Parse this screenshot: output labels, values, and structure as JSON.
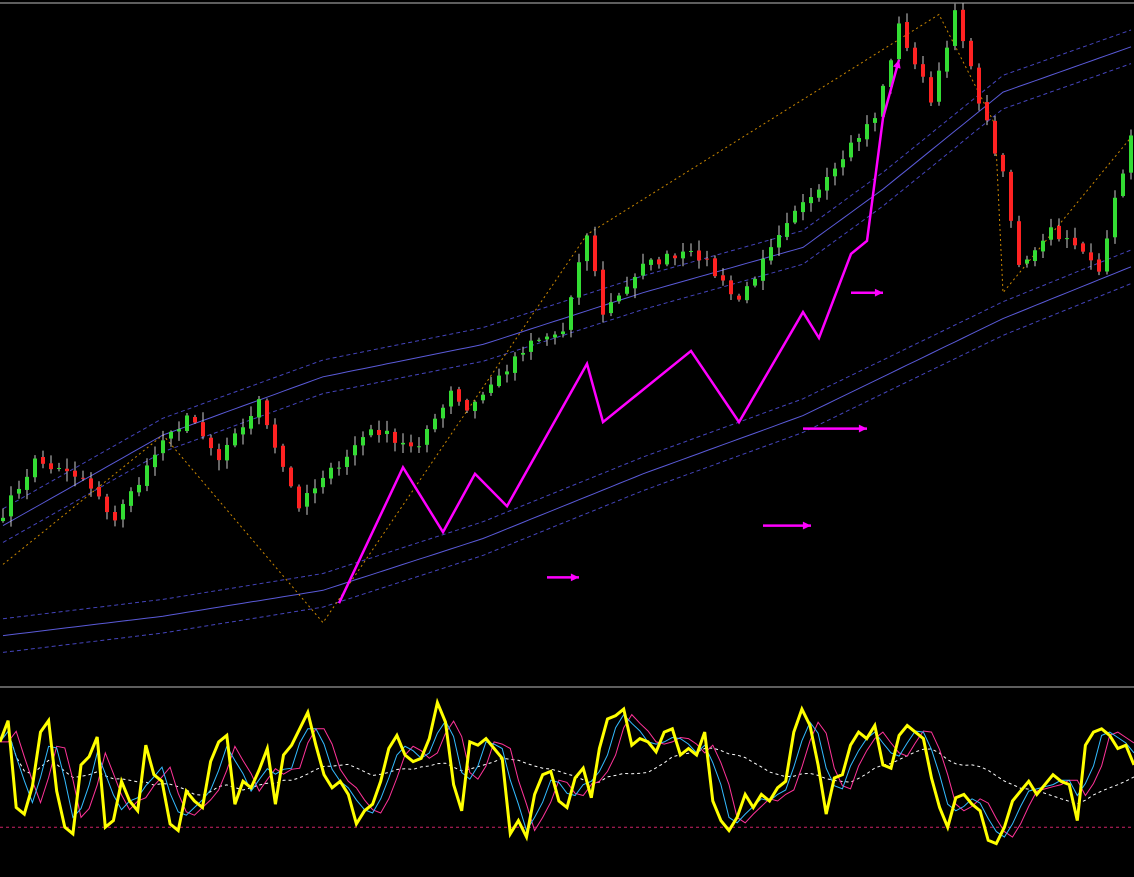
{
  "chart_data": [
    {
      "type": "candlestick",
      "panel": "price",
      "grid": false,
      "legend": "none",
      "y_range": [
        0,
        100
      ],
      "colors": {
        "background": "#000000",
        "bull_candle": "#33dd33",
        "bear_candle": "#ff2222",
        "wick": "#cccccc",
        "envelope_solid": "#5a5ad8",
        "envelope_dashed": "#4444bb",
        "zigzag": "#cc8800",
        "annotation_arrows": "#ff00ff"
      },
      "price_path": [
        {
          "i": 0,
          "v": 22
        },
        {
          "i": 4,
          "v": 30
        },
        {
          "i": 10,
          "v": 27
        },
        {
          "i": 14,
          "v": 21
        },
        {
          "i": 19,
          "v": 31
        },
        {
          "i": 23,
          "v": 37
        },
        {
          "i": 27,
          "v": 30
        },
        {
          "i": 32,
          "v": 39
        },
        {
          "i": 37,
          "v": 23
        },
        {
          "i": 46,
          "v": 35
        },
        {
          "i": 52,
          "v": 32
        },
        {
          "i": 56,
          "v": 41
        },
        {
          "i": 58,
          "v": 38
        },
        {
          "i": 66,
          "v": 48
        },
        {
          "i": 70,
          "v": 50
        },
        {
          "i": 73,
          "v": 65
        },
        {
          "i": 75,
          "v": 53
        },
        {
          "i": 80,
          "v": 60
        },
        {
          "i": 86,
          "v": 63
        },
        {
          "i": 92,
          "v": 55
        },
        {
          "i": 99,
          "v": 68
        },
        {
          "i": 106,
          "v": 79
        },
        {
          "i": 109,
          "v": 83
        },
        {
          "i": 112,
          "v": 97
        },
        {
          "i": 116,
          "v": 86
        },
        {
          "i": 119,
          "v": 99
        },
        {
          "i": 122,
          "v": 86
        },
        {
          "i": 125,
          "v": 74
        },
        {
          "i": 127,
          "v": 60
        },
        {
          "i": 131,
          "v": 66
        },
        {
          "i": 137,
          "v": 60
        },
        {
          "i": 141,
          "v": 80
        }
      ],
      "envelope_upper": [
        [
          0,
          20
        ],
        [
          20,
          34
        ],
        [
          40,
          43
        ],
        [
          60,
          48
        ],
        [
          80,
          56
        ],
        [
          100,
          63
        ],
        [
          110,
          72
        ],
        [
          125,
          87
        ],
        [
          141,
          94
        ]
      ],
      "envelope_lower": [
        [
          0,
          3
        ],
        [
          20,
          6
        ],
        [
          40,
          10
        ],
        [
          60,
          18
        ],
        [
          80,
          28
        ],
        [
          100,
          37
        ],
        [
          110,
          43
        ],
        [
          125,
          52
        ],
        [
          141,
          60
        ]
      ],
      "zigzag": [
        [
          0,
          14
        ],
        [
          20,
          34
        ],
        [
          40,
          5
        ],
        [
          73,
          65
        ],
        [
          117,
          99
        ],
        [
          124,
          82
        ],
        [
          125,
          56
        ],
        [
          141,
          80
        ]
      ],
      "annotation_arrows": [
        [
          [
            42,
            8
          ],
          [
            50,
            29
          ],
          [
            55,
            19
          ],
          [
            59,
            28
          ],
          [
            63,
            23
          ],
          [
            73,
            45
          ],
          [
            75,
            36
          ],
          [
            86,
            47
          ],
          [
            92,
            36
          ],
          [
            100,
            53
          ],
          [
            102,
            49
          ],
          [
            106,
            62
          ],
          [
            108,
            64
          ],
          [
            110,
            83
          ],
          [
            112,
            92
          ]
        ],
        [
          [
            68,
            12
          ],
          [
            72,
            12
          ]
        ],
        [
          [
            95,
            20
          ],
          [
            101,
            20
          ]
        ],
        [
          [
            100,
            35
          ],
          [
            108,
            35
          ]
        ],
        [
          [
            106,
            56
          ],
          [
            110,
            56
          ]
        ]
      ]
    },
    {
      "type": "line",
      "panel": "oscillator",
      "grid": false,
      "legend": "none",
      "y_range": [
        0,
        100
      ],
      "colors": {
        "main": "#ffff00",
        "signal_a": "#33bbff",
        "signal_b": "#ff3399",
        "slow": "#ffffff",
        "level": "#cc2266"
      },
      "series": [
        {
          "values": [
            72,
            85,
            32,
            28,
            45,
            78,
            85,
            42,
            20,
            16,
            58,
            63,
            75,
            20,
            24,
            48,
            36,
            30,
            70,
            52,
            48,
            22,
            18,
            42,
            36,
            32,
            60,
            72,
            76,
            34,
            48,
            44,
            55,
            68,
            34,
            64,
            70,
            80,
            90,
            70,
            52,
            44,
            48,
            40,
            22,
            30,
            34,
            48,
            68,
            76,
            64,
            60,
            62,
            74,
            96,
            84,
            46,
            30,
            72,
            70,
            74,
            68,
            62,
            16,
            24,
            14,
            40,
            52,
            54,
            36,
            32,
            50,
            56,
            38,
            68,
            86,
            88,
            92,
            70,
            74,
            72,
            66,
            78,
            80,
            64,
            68,
            64,
            78,
            36,
            24,
            18,
            26,
            40,
            32,
            40,
            36,
            44,
            48,
            78,
            92,
            82,
            58,
            28,
            50,
            52,
            70,
            78,
            74,
            82,
            58,
            56,
            76,
            82,
            78,
            74,
            50,
            32,
            20,
            38,
            40,
            34,
            30,
            12,
            10,
            20,
            36,
            42,
            48,
            40,
            46,
            52,
            48,
            46,
            24,
            70,
            78,
            80,
            76,
            68,
            70,
            58
          ]
        }
      ],
      "levels": [
        20
      ]
    }
  ]
}
